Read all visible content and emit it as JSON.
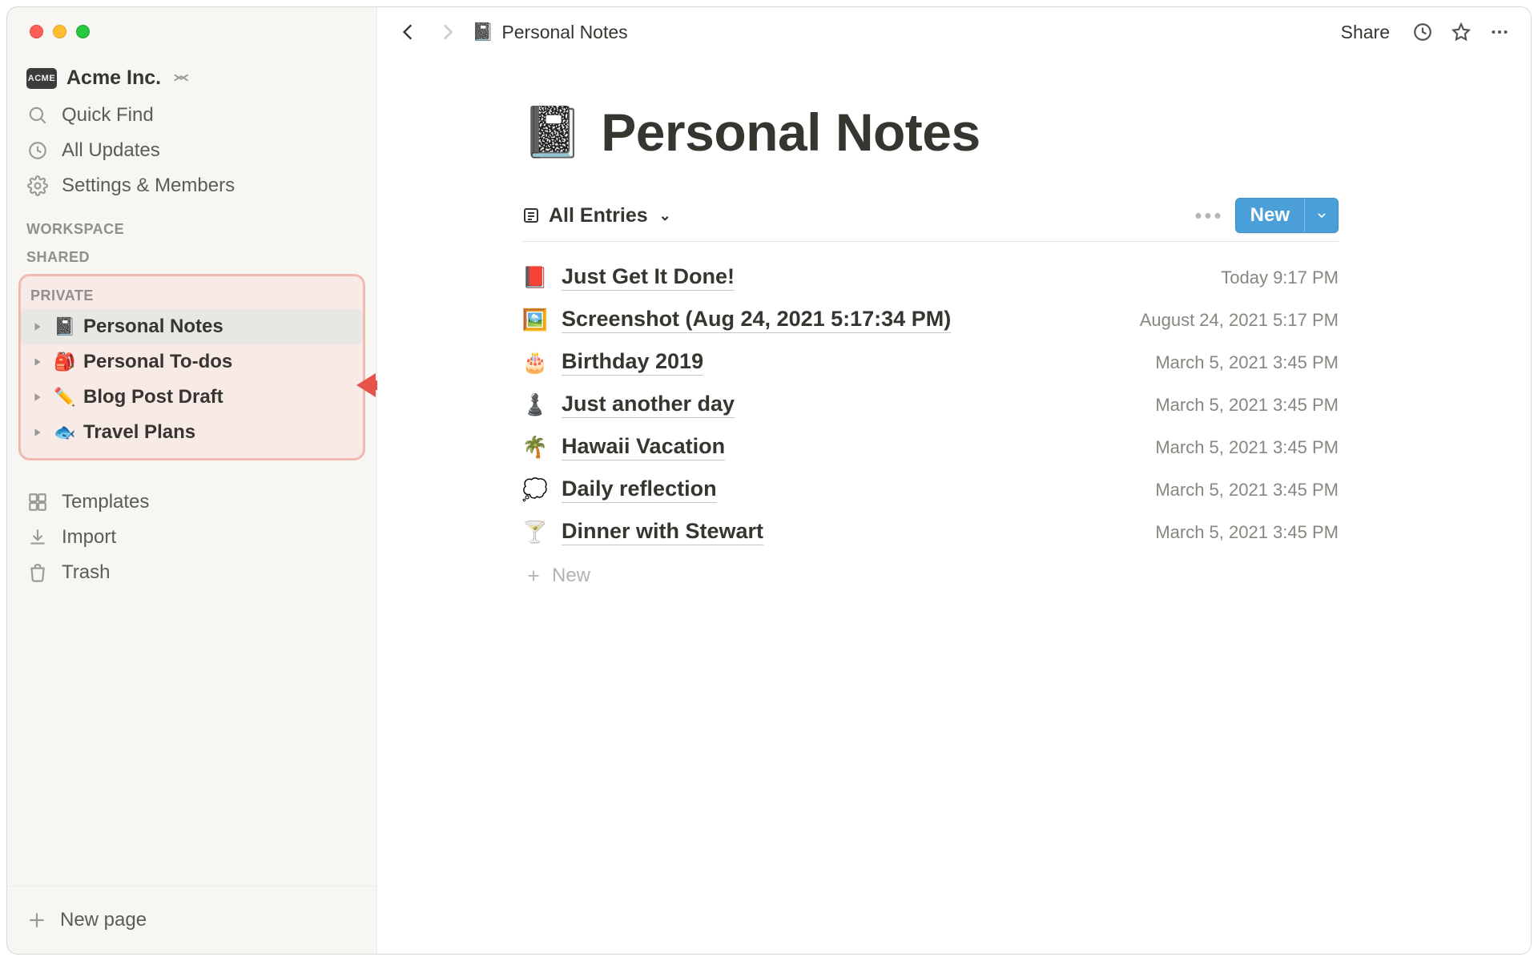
{
  "workspace": {
    "badge": "ACME",
    "name": "Acme Inc."
  },
  "sidebar": {
    "quick_find": "Quick Find",
    "all_updates": "All Updates",
    "settings": "Settings & Members",
    "sections": {
      "workspace": "WORKSPACE",
      "shared": "SHARED",
      "private": "PRIVATE"
    },
    "private_pages": [
      {
        "emoji": "📓",
        "label": "Personal Notes",
        "selected": true
      },
      {
        "emoji": "🎒",
        "label": "Personal To-dos",
        "selected": false
      },
      {
        "emoji": "✏️",
        "label": "Blog Post Draft",
        "selected": false
      },
      {
        "emoji": "🐟",
        "label": "Travel Plans",
        "selected": false
      }
    ],
    "templates": "Templates",
    "import": "Import",
    "trash": "Trash",
    "new_page": "New page"
  },
  "topbar": {
    "breadcrumb_emoji": "📓",
    "breadcrumb": "Personal Notes",
    "share": "Share"
  },
  "page": {
    "title_emoji": "📓",
    "title": "Personal Notes",
    "view_label": "All Entries",
    "new_button": "New",
    "new_row": "New"
  },
  "entries": [
    {
      "emoji": "📕",
      "title": "Just Get It Done!",
      "date": "Today 9:17 PM"
    },
    {
      "emoji": "🖼️",
      "title": "Screenshot (Aug 24, 2021 5:17:34 PM)",
      "date": "August 24, 2021 5:17 PM"
    },
    {
      "emoji": "🎂",
      "title": "Birthday 2019",
      "date": "March 5, 2021 3:45 PM"
    },
    {
      "emoji": "♟️",
      "title": "Just another day",
      "date": "March 5, 2021 3:45 PM"
    },
    {
      "emoji": "🌴",
      "title": "Hawaii Vacation",
      "date": "March 5, 2021 3:45 PM"
    },
    {
      "emoji": "💭",
      "title": "Daily reflection",
      "date": "March 5, 2021 3:45 PM"
    },
    {
      "emoji": "🍸",
      "title": "Dinner with Stewart",
      "date": "March 5, 2021 3:45 PM"
    }
  ]
}
